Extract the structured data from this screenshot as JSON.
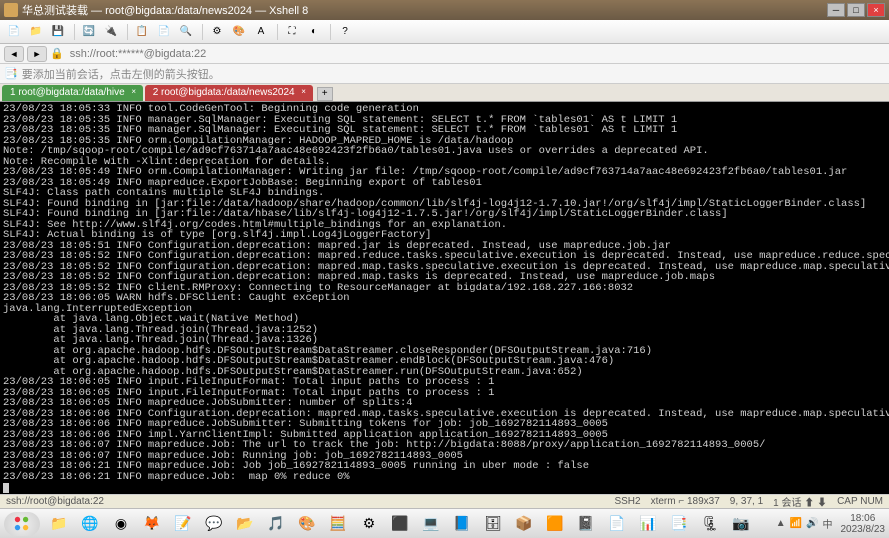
{
  "titlebar": {
    "text": "华总测试装载 — root@bigdata:/data/news2024 — Xshell 8"
  },
  "addr": {
    "url": "ssh://root:******@bigdata:22"
  },
  "search": {
    "hint": "要添加当前会话，点击左侧的箭头按钮。"
  },
  "tabs": [
    {
      "label": "1 root@bigdata:/data/hive",
      "class": "green"
    },
    {
      "label": "2 root@bigdata:/data/news2024",
      "class": "red"
    }
  ],
  "terminal_lines": [
    "23/08/23 18:05:33 INFO tool.CodeGenTool: Beginning code generation",
    "23/08/23 18:05:35 INFO manager.SqlManager: Executing SQL statement: SELECT t.* FROM `tables01` AS t LIMIT 1",
    "23/08/23 18:05:35 INFO manager.SqlManager: Executing SQL statement: SELECT t.* FROM `tables01` AS t LIMIT 1",
    "23/08/23 18:05:35 INFO orm.CompilationManager: HADOOP_MAPRED_HOME is /data/hadoop",
    "Note: /tmp/sqoop-root/compile/ad9cf763714a7aac48e692423f2fb6a0/tables01.java uses or overrides a deprecated API.",
    "Note: Recompile with -Xlint:deprecation for details.",
    "23/08/23 18:05:49 INFO orm.CompilationManager: Writing jar file: /tmp/sqoop-root/compile/ad9cf763714a7aac48e692423f2fb6a0/tables01.jar",
    "23/08/23 18:05:49 INFO mapreduce.ExportJobBase: Beginning export of tables01",
    "SLF4J: Class path contains multiple SLF4J bindings.",
    "SLF4J: Found binding in [jar:file:/data/hadoop/share/hadoop/common/lib/slf4j-log4j12-1.7.10.jar!/org/slf4j/impl/StaticLoggerBinder.class]",
    "SLF4J: Found binding in [jar:file:/data/hbase/lib/slf4j-log4j12-1.7.5.jar!/org/slf4j/impl/StaticLoggerBinder.class]",
    "SLF4J: See http://www.slf4j.org/codes.html#multiple_bindings for an explanation.",
    "SLF4J: Actual binding is of type [org.slf4j.impl.Log4jLoggerFactory]",
    "23/08/23 18:05:51 INFO Configuration.deprecation: mapred.jar is deprecated. Instead, use mapreduce.job.jar",
    "23/08/23 18:05:52 INFO Configuration.deprecation: mapred.reduce.tasks.speculative.execution is deprecated. Instead, use mapreduce.reduce.speculative",
    "23/08/23 18:05:52 INFO Configuration.deprecation: mapred.map.tasks.speculative.execution is deprecated. Instead, use mapreduce.map.speculative",
    "23/08/23 18:05:52 INFO Configuration.deprecation: mapred.map.tasks is deprecated. Instead, use mapreduce.job.maps",
    "23/08/23 18:05:52 INFO client.RMProxy: Connecting to ResourceManager at bigdata/192.168.227.166:8032",
    "23/08/23 18:06:05 WARN hdfs.DFSClient: Caught exception",
    "java.lang.InterruptedException",
    "\tat java.lang.Object.wait(Native Method)",
    "\tat java.lang.Thread.join(Thread.java:1252)",
    "\tat java.lang.Thread.join(Thread.java:1326)",
    "\tat org.apache.hadoop.hdfs.DFSOutputStream$DataStreamer.closeResponder(DFSOutputStream.java:716)",
    "\tat org.apache.hadoop.hdfs.DFSOutputStream$DataStreamer.endBlock(DFSOutputStream.java:476)",
    "\tat org.apache.hadoop.hdfs.DFSOutputStream$DataStreamer.run(DFSOutputStream.java:652)",
    "23/08/23 18:06:05 INFO input.FileInputFormat: Total input paths to process : 1",
    "23/08/23 18:06:05 INFO input.FileInputFormat: Total input paths to process : 1",
    "23/08/23 18:06:05 INFO mapreduce.JobSubmitter: number of splits:4",
    "23/08/23 18:06:06 INFO Configuration.deprecation: mapred.map.tasks.speculative.execution is deprecated. Instead, use mapreduce.map.speculative",
    "23/08/23 18:06:06 INFO mapreduce.JobSubmitter: Submitting tokens for job: job_1692782114893_0005",
    "23/08/23 18:06:06 INFO impl.YarnClientImpl: Submitted application application_1692782114893_0005",
    "23/08/23 18:06:07 INFO mapreduce.Job: The url to track the job: http://bigdata:8088/proxy/application_1692782114893_0005/",
    "23/08/23 18:06:07 INFO mapreduce.Job: Running job: job_1692782114893_0005",
    "23/08/23 18:06:21 INFO mapreduce.Job: Job job_1692782114893_0005 running in uber mode : false",
    "23/08/23 18:06:21 INFO mapreduce.Job:  map 0% reduce 0%"
  ],
  "statusbar": {
    "left": "ssh://root@bigdata:22",
    "mid": "SSH2",
    "encoding": "xterm  ⌐ 189x37",
    "pos": "9, 37, 1",
    "lang": "1 会话  ⬆ ⬇",
    "cap": "CAP NUM"
  },
  "taskbar": {
    "time": "18:06",
    "date": "2023/8/23"
  }
}
